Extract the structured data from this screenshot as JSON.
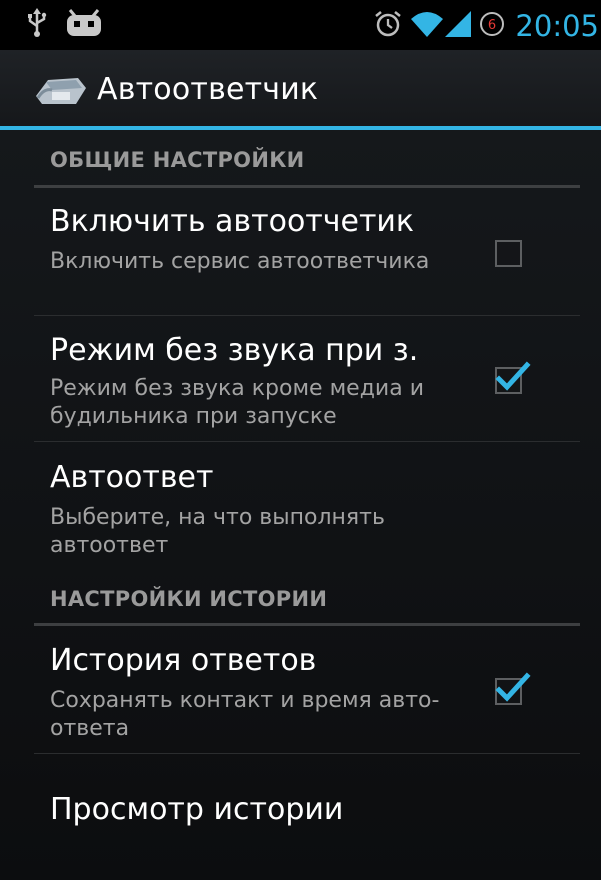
{
  "status_bar": {
    "time": "20:05",
    "icons": [
      "usb-icon",
      "android-debug-icon",
      "alarm-icon",
      "wifi-icon",
      "signal-icon",
      "notification-count-icon"
    ],
    "notification_count": "6",
    "accent_color": "#33b5e5"
  },
  "action_bar": {
    "title": "Автоответчик",
    "icon": "app-phone-icon",
    "accent_color": "#33b5e5"
  },
  "sections": [
    {
      "header": "ОБЩИЕ НАСТРОЙКИ",
      "items": [
        {
          "title": "Включить автоотчетик",
          "summary": "Включить сервис автоответчика",
          "checked": false
        },
        {
          "title": "Режим без звука при з.",
          "summary": "Режим без звука кроме медиа и будильника при запуске",
          "checked": true
        },
        {
          "title": "Автоответ",
          "summary": "Выберите, на что выполнять автоответ"
        }
      ]
    },
    {
      "header": "НАСТРОЙКИ ИСТОРИИ",
      "items": [
        {
          "title": "История ответов",
          "summary": "Сохранять контакт и время авто-ответа",
          "checked": true
        },
        {
          "title": "Просмотр истории"
        }
      ]
    }
  ]
}
